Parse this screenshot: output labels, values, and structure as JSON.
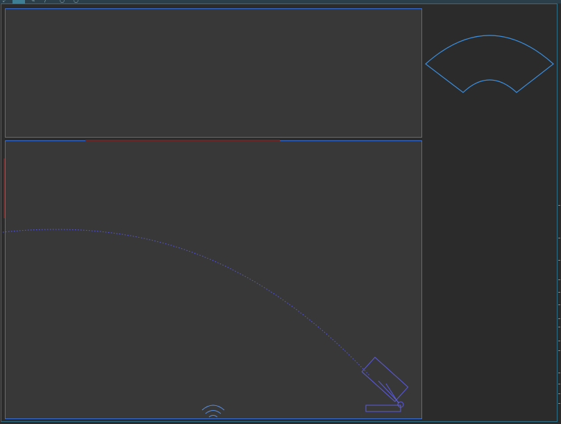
{
  "window": {
    "title": "",
    "frame_color": "#2f6f86",
    "tabbar_color": "#2a3f4a",
    "active_tab_color": "#3f7f95"
  },
  "toolbar": {
    "icons": [
      "pointer-icon",
      "pen-icon",
      "line-icon",
      "shape-icon",
      "node-icon"
    ]
  },
  "canvas": {
    "background": "#383838",
    "pane_border": "#3a6fd2",
    "marker_color": "#7a2020"
  },
  "scene": {
    "elements": [
      "annular-sector-shape",
      "wifi-signal-icon",
      "projectile-trajectory",
      "cannon-icon"
    ],
    "trajectory_style": "dotted",
    "accent_color": "#5a5ae0"
  }
}
